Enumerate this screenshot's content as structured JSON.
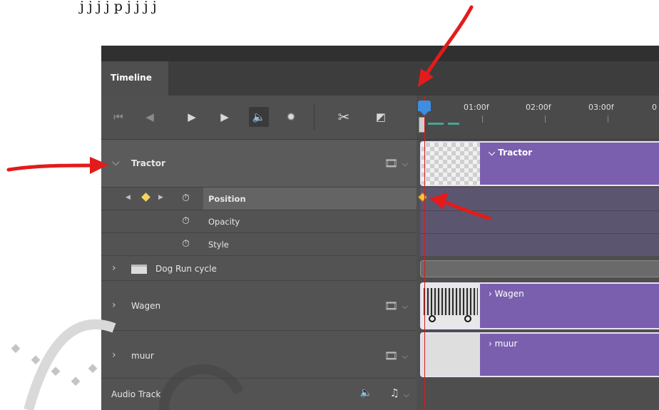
{
  "caption": {
    "text": "j j j j p j j j j"
  },
  "timeline": {
    "tab_label": "Timeline",
    "ruler_ticks": [
      "01:00f",
      "02:00f",
      "03:00f",
      "0"
    ],
    "layers": {
      "tractor": "Tractor",
      "properties": [
        "Position",
        "Opacity",
        "Style"
      ],
      "dog_run": "Dog Run cycle",
      "wagen": "Wagen",
      "muur": "muur",
      "audio": "Audio Track"
    },
    "clips": {
      "tractor": "Tractor",
      "wagen": "Wagen",
      "muur": "muur"
    },
    "accent_colors": {
      "clip": "#7a5fae",
      "playhead": "#3e8de0",
      "keyframe": "#f4d35e",
      "annotation_arrow": "#e31b1b"
    },
    "icons": {
      "controls": [
        "go-to-start-icon",
        "step-back-icon",
        "play-icon",
        "step-forward-icon",
        "audio-toggle-icon",
        "settings-icon",
        "split-scissors-icon",
        "transition-icon"
      ],
      "layer": [
        "film-strip-icon",
        "stopwatch-icon",
        "folder-icon",
        "music-note-icon"
      ]
    }
  }
}
